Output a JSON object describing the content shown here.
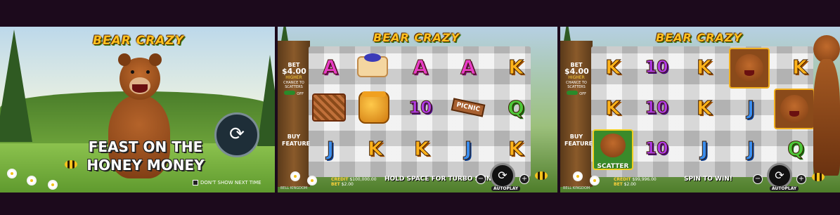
{
  "game": {
    "logo": "BEAR CRAZY"
  },
  "intro": {
    "tagline_line1": "FEAST ON THE",
    "tagline_line2": "HONEY MONEY",
    "dont_show_label": "DON'T SHOW NEXT TIME"
  },
  "spin_screen_1": {
    "bet_label": "BET",
    "bet_value": "$4.00",
    "higher_label": "HIGHER",
    "chance_label": "CHANCE TO SCATTERS",
    "toggle_state": "OFF",
    "buy_feature_line1": "BUY",
    "buy_feature_line2": "FEATURE",
    "credit_label": "CREDIT",
    "credit_value": "$100,000.00",
    "bet_bottom_label": "BET",
    "bet_bottom_value": "$2.00",
    "message": "HOLD SPACE FOR TURBO SPIN",
    "minus": "−",
    "plus": "+",
    "autoplay": "AUTOPLAY",
    "brand": "BELL KINGDOM",
    "reels": [
      [
        "A",
        "blueberry-pie",
        "A",
        "A",
        "K"
      ],
      [
        "picnic-basket",
        "honey-jar",
        "10",
        "picnic-sign",
        "Q"
      ],
      [
        "J",
        "K",
        "K",
        "J",
        "K"
      ]
    ],
    "picnic_sign_text": "PICNIC"
  },
  "spin_screen_2": {
    "bet_label": "BET",
    "bet_value": "$4.00",
    "higher_label": "HIGHER",
    "chance_label": "CHANCE TO SCATTERS",
    "toggle_state": "OFF",
    "buy_feature_line1": "BUY",
    "buy_feature_line2": "FEATURE",
    "credit_label": "CREDIT",
    "credit_value": "$99,996.00",
    "bet_bottom_label": "BET",
    "bet_bottom_value": "$2.00",
    "message": "SPIN TO WIN!",
    "minus": "−",
    "plus": "+",
    "autoplay": "AUTOPLAY",
    "brand": "BELL KINGDOM",
    "reels": [
      [
        "K",
        "10",
        "K",
        "bear-wild",
        "K"
      ],
      [
        "K",
        "10",
        "K",
        "J",
        "bear-wild"
      ],
      [
        "scatter-bear",
        "10",
        "J",
        "J",
        "Q"
      ]
    ],
    "scatter_label": "SCATTER"
  },
  "colors": {
    "background": "#1c0a1c",
    "logo": "#ffc21f",
    "accent_green": "#2a8a2a"
  }
}
